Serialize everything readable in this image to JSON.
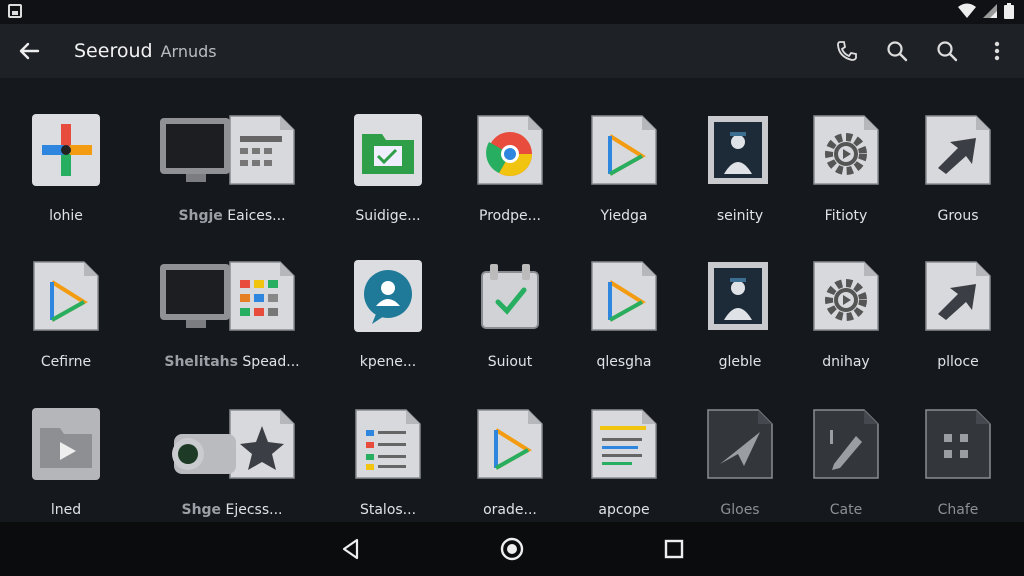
{
  "status_bar": {
    "left_icon": "image-icon",
    "right_icons": [
      "wifi-icon",
      "signal-icon",
      "battery-icon"
    ]
  },
  "toolbar": {
    "title": "Seeroud",
    "subtitle": "Arnuds"
  },
  "actions": [
    "phone-icon",
    "search-icon",
    "search-icon",
    "more-vert-icon"
  ],
  "grid": {
    "rows": [
      [
        {
          "label": "lohie",
          "icon": "pinwheel"
        },
        {
          "label_dim": "Shgje",
          "label": "Eaices...",
          "icon": "monitor-doc"
        },
        {
          "label": "Suidige...",
          "icon": "folder-green"
        },
        {
          "label": "Prodpe...",
          "icon": "chrome-doc"
        },
        {
          "label": "Yiedga",
          "icon": "play-doc"
        },
        {
          "label": "seinity",
          "icon": "photo-doc"
        },
        {
          "label": "Fitioty",
          "icon": "gear-doc"
        },
        {
          "label": "Grous",
          "icon": "arrow-doc"
        }
      ],
      [
        {
          "label": "Cefirne",
          "icon": "play-doc"
        },
        {
          "label_dim": "Shelitahs",
          "label": "Spead...",
          "icon": "monitor-grid"
        },
        {
          "label": "kpene...",
          "icon": "chat-person"
        },
        {
          "label": "Suiout",
          "icon": "check-box"
        },
        {
          "label": "qlesgha",
          "icon": "play-doc"
        },
        {
          "label": "gleble",
          "icon": "photo-doc"
        },
        {
          "label": "dnihay",
          "icon": "gear-doc"
        },
        {
          "label": "plloce",
          "icon": "arrow-doc"
        }
      ],
      [
        {
          "label": "lned",
          "icon": "folder-play"
        },
        {
          "label_dim": "Shge",
          "label": "Ejecss...",
          "icon": "camera-star"
        },
        {
          "label": "Stalos...",
          "icon": "list-doc"
        },
        {
          "label": "orade...",
          "icon": "play-doc"
        },
        {
          "label": "apcope",
          "icon": "notes-doc"
        },
        {
          "label": "Gloes",
          "icon": "send-dark",
          "faded": true
        },
        {
          "label": "Cate",
          "icon": "edit-dark",
          "faded": true
        },
        {
          "label": "Chafe",
          "icon": "apps-dark",
          "faded": true
        }
      ]
    ]
  },
  "nav": [
    "back-triangle-icon",
    "home-circle-icon",
    "recents-square-icon"
  ]
}
